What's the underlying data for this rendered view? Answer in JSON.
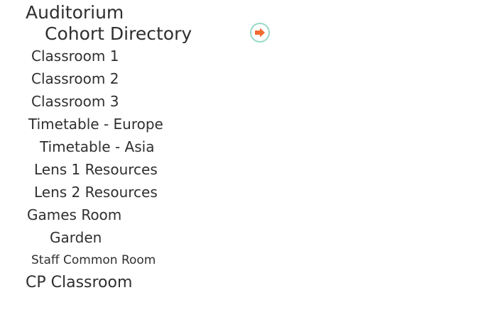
{
  "nav": {
    "auditorium": "Auditorium",
    "cohort_directory": "Cohort Directory",
    "classroom_1": "Classroom 1",
    "classroom_2": "Classroom 2",
    "classroom_3": "Classroom 3",
    "timetable_europe": "Timetable - Europe",
    "timetable_asia": "Timetable - Asia",
    "lens_1_resources": "Lens 1 Resources",
    "lens_2_resources": "Lens 2 Resources",
    "games_room": "Games Room",
    "garden": "Garden",
    "staff_common_room": "Staff Common Room",
    "cp_classroom": "CP Classroom"
  },
  "arrow_button": {
    "icon": "arrow-right-icon",
    "icon_color": "#f26b2f",
    "ring_color": "#9ad9c8"
  }
}
